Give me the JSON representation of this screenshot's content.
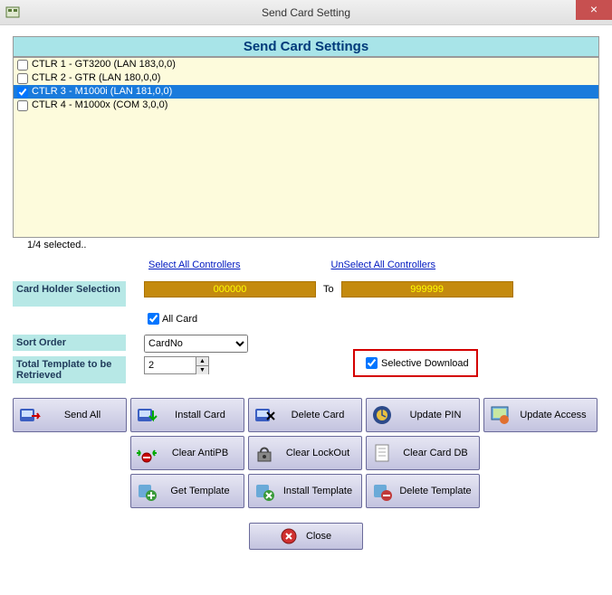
{
  "window": {
    "title": "Send Card Setting"
  },
  "header": {
    "title": "Send Card Settings"
  },
  "controllers": [
    {
      "label": "CTLR 1 - GT3200 (LAN 183,0,0)",
      "checked": false,
      "selected": false
    },
    {
      "label": "CTLR 2 - GTR (LAN 180,0,0)",
      "checked": false,
      "selected": false
    },
    {
      "label": "CTLR 3 - M1000i (LAN 181,0,0)",
      "checked": true,
      "selected": true
    },
    {
      "label": "CTLR 4 - M1000x (COM 3,0,0)",
      "checked": false,
      "selected": false
    }
  ],
  "selection_count": "1/4 selected..",
  "links": {
    "select_all": "Select All Controllers",
    "unselect_all": "UnSelect All Controllers"
  },
  "cardholder": {
    "label": "Card Holder Selection",
    "from": "000000",
    "to_label": "To",
    "to": "999999",
    "allcard_label": "All Card",
    "allcard_checked": true
  },
  "sortorder": {
    "label": "Sort Order",
    "value": "CardNo"
  },
  "selective": {
    "label": "Selective Download",
    "checked": true
  },
  "totaltemplate": {
    "label": "Total Template to be Retrieved",
    "value": "2"
  },
  "buttons": {
    "send_all": "Send All",
    "install_card": "Install Card",
    "delete_card": "Delete Card",
    "update_pin": "Update PIN",
    "update_access": "Update Access",
    "clear_antipb": "Clear AntiPB",
    "clear_lockout": "Clear LockOut",
    "clear_carddb": "Clear Card DB",
    "get_template": "Get Template",
    "install_template": "Install Template",
    "delete_template": "Delete Template",
    "close": "Close"
  }
}
